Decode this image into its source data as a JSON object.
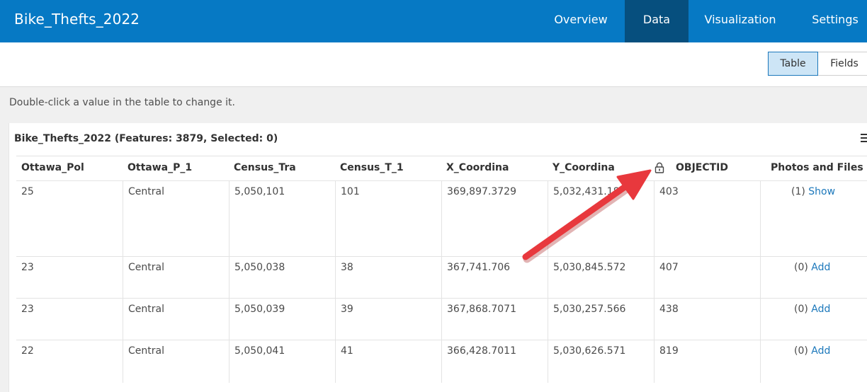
{
  "header": {
    "title": "Bike_Thefts_2022",
    "tabs": [
      {
        "label": "Overview"
      },
      {
        "label": "Data"
      },
      {
        "label": "Visualization"
      },
      {
        "label": "Settings"
      }
    ],
    "active_tab": "Data"
  },
  "toolbar": {
    "view_table": "Table",
    "view_fields": "Fields"
  },
  "hint": "Double-click a value in the table to change it.",
  "table": {
    "title": "Bike_Thefts_2022 (Features: 3879, Selected: 0)",
    "columns": [
      "Ottawa_Pol",
      "Ottawa_P_1",
      "Census_Tra",
      "Census_T_1",
      "X_Coordina",
      "Y_Coordina",
      "OBJECTID",
      "Photos and Files"
    ],
    "rows": [
      {
        "cells": [
          "25",
          "Central",
          "5,050,101",
          "101",
          "369,897.3729",
          "5,032,431.18",
          "403"
        ],
        "count": "(1)",
        "action": "Show"
      },
      {
        "cells": [
          "23",
          "Central",
          "5,050,038",
          "38",
          "367,741.706",
          "5,030,845.572",
          "407"
        ],
        "count": "(0)",
        "action": "Add"
      },
      {
        "cells": [
          "23",
          "Central",
          "5,050,039",
          "39",
          "367,868.7071",
          "5,030,257.566",
          "438"
        ],
        "count": "(0)",
        "action": "Add"
      },
      {
        "cells": [
          "22",
          "Central",
          "5,050,041",
          "41",
          "366,428.7011",
          "5,030,626.571",
          "819"
        ],
        "count": "(0)",
        "action": "Add"
      }
    ]
  },
  "icons": {
    "lock": "lock-icon",
    "menu": "menu-icon",
    "annotation": "red-arrow"
  },
  "colors": {
    "header_bg": "#0679c4",
    "active_tab_bg": "#064f7e",
    "link": "#1c78bb",
    "arrow": "#e8383d"
  }
}
